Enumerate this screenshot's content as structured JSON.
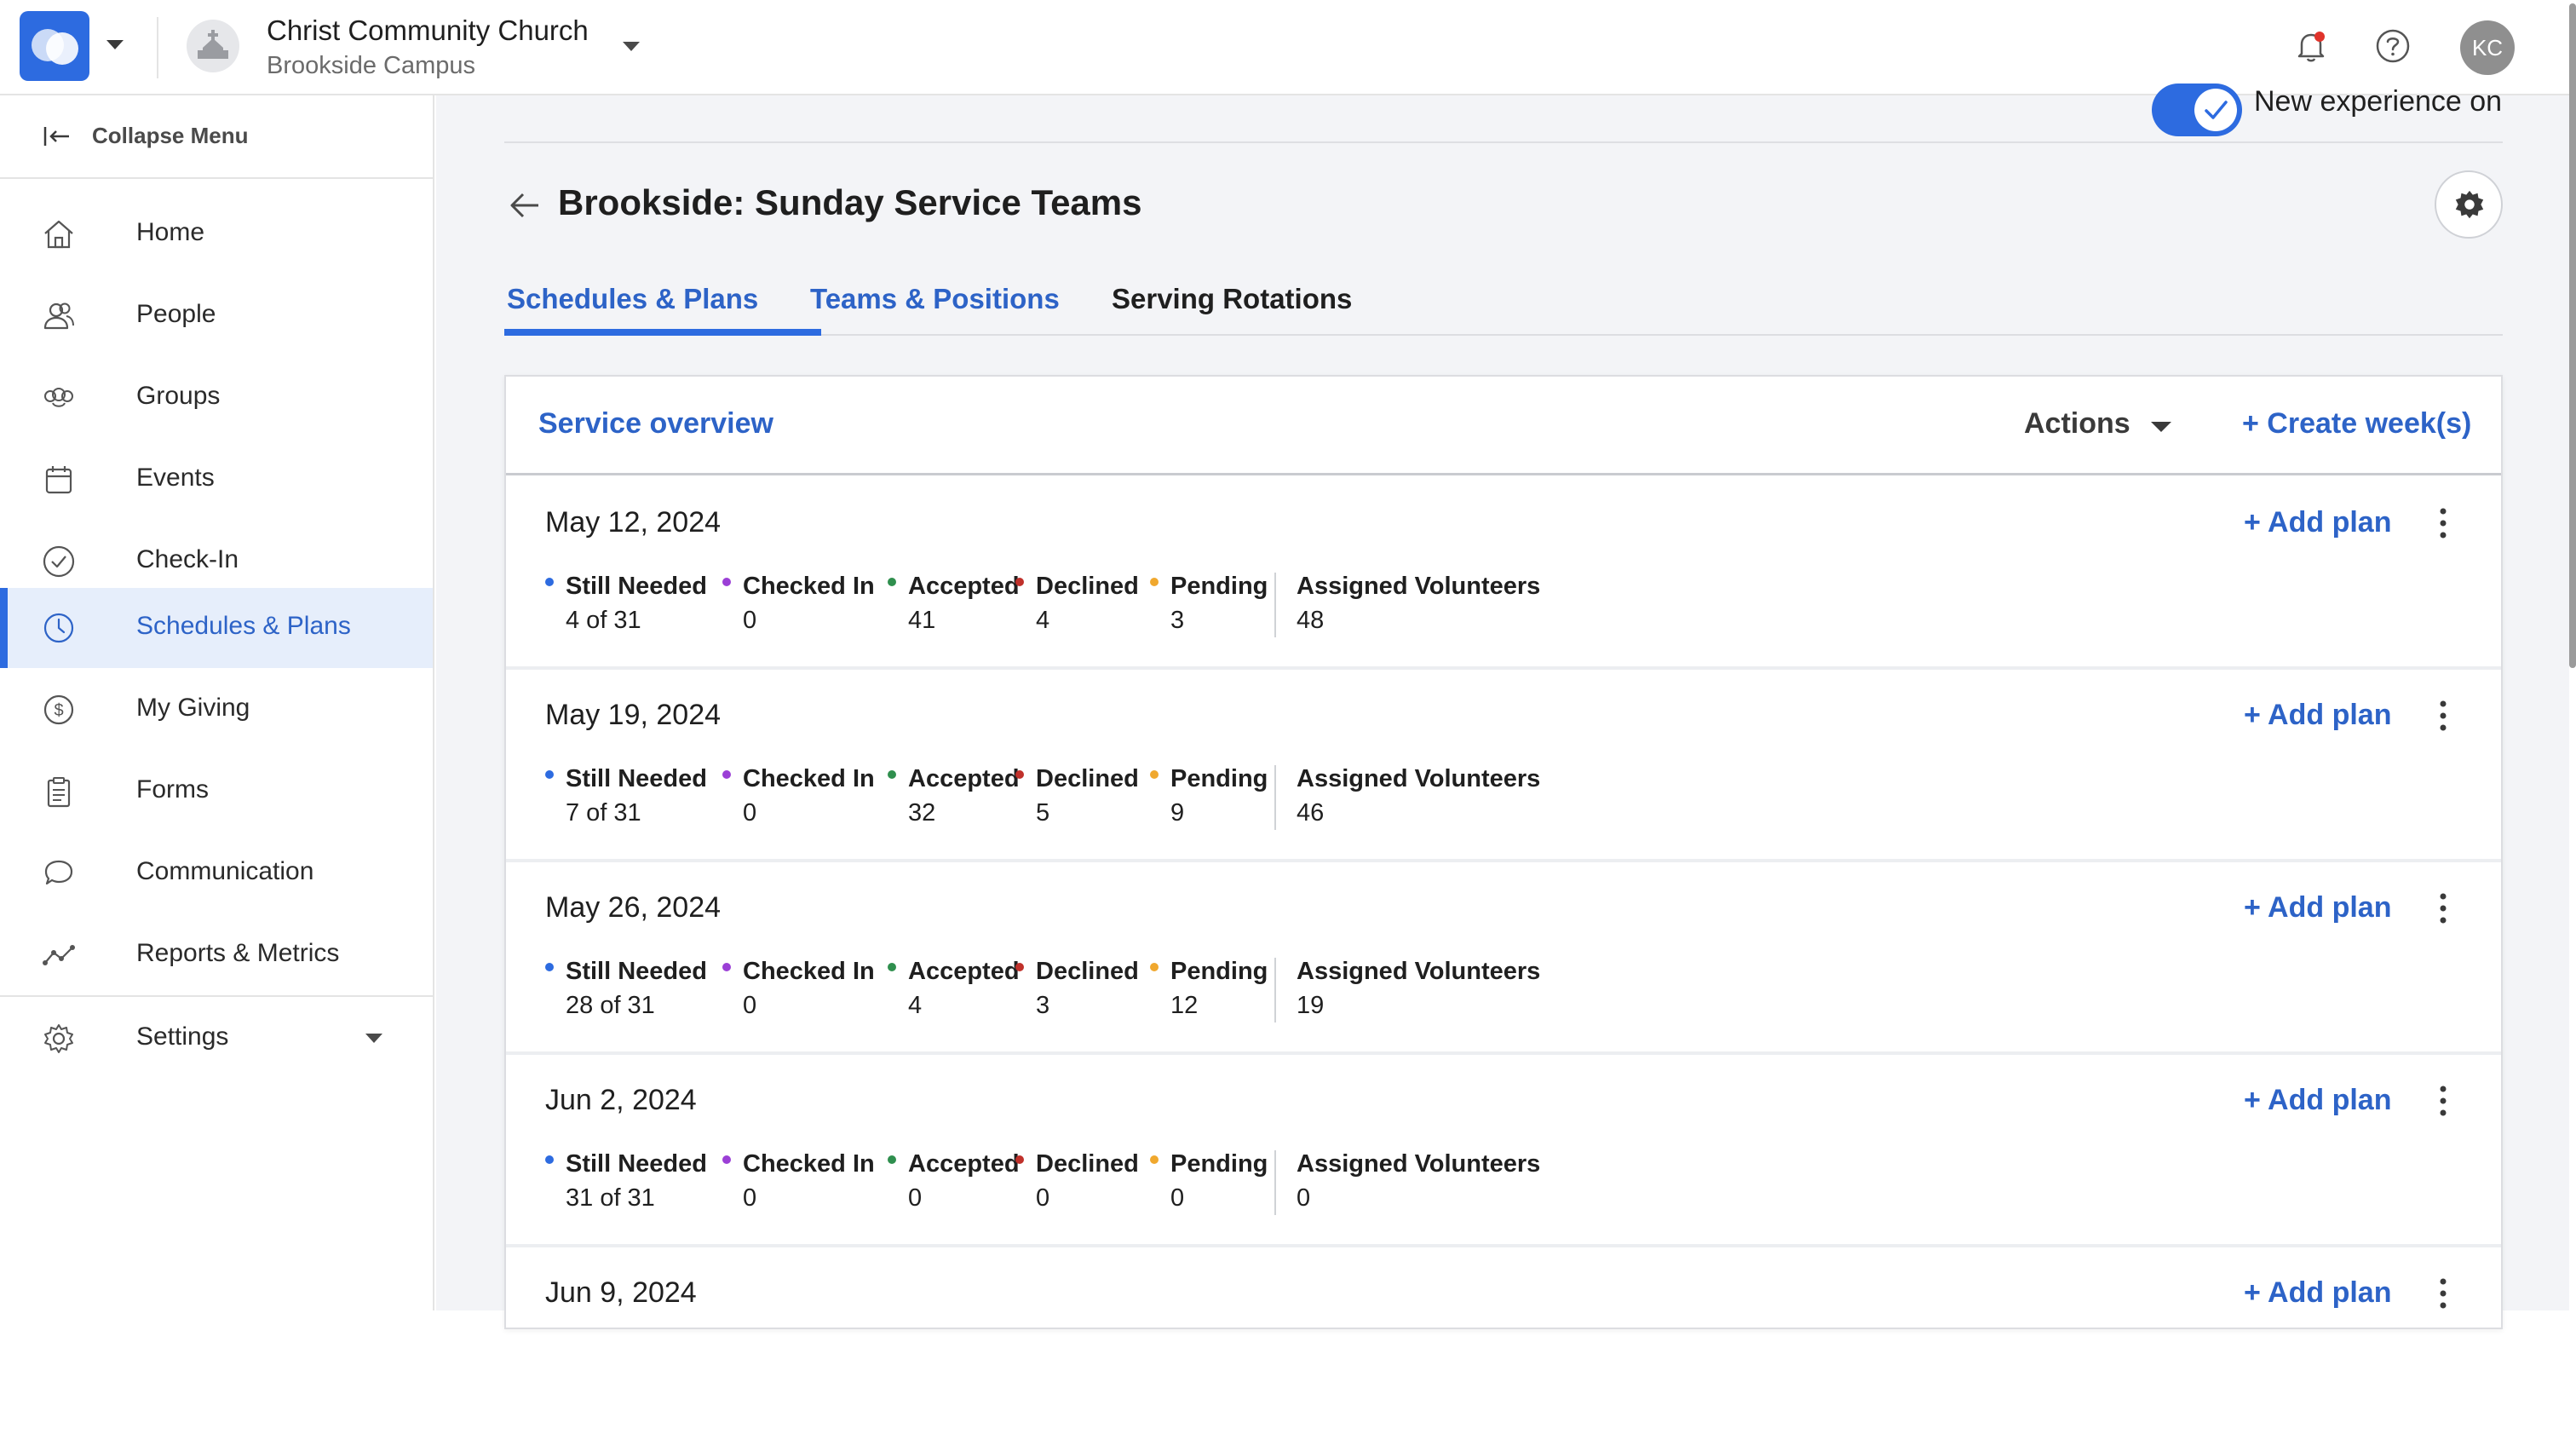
{
  "header": {
    "org_name": "Christ Community Church",
    "campus": "Brookside Campus",
    "user_initials": "KC"
  },
  "sidebar": {
    "collapse_label": "Collapse Menu",
    "items": [
      {
        "label": "Home",
        "icon": "home-icon"
      },
      {
        "label": "People",
        "icon": "people-icon"
      },
      {
        "label": "Groups",
        "icon": "groups-icon"
      },
      {
        "label": "Events",
        "icon": "calendar-icon"
      },
      {
        "label": "Check-In",
        "icon": "check-circle-icon"
      },
      {
        "label": "Schedules & Plans",
        "icon": "clock-icon",
        "active": true
      },
      {
        "label": "My Giving",
        "icon": "dollar-icon"
      },
      {
        "label": "Forms",
        "icon": "clipboard-icon"
      },
      {
        "label": "Communication",
        "icon": "chat-icon"
      },
      {
        "label": "Reports & Metrics",
        "icon": "metrics-icon"
      },
      {
        "label": "Settings",
        "icon": "gear-icon"
      }
    ]
  },
  "main": {
    "toggle_label": "New experience on",
    "toggle_on": true,
    "page_title": "Brookside: Sunday Service Teams",
    "tabs": [
      {
        "label": "Schedules & Plans",
        "active": true
      },
      {
        "label": "Teams & Positions"
      },
      {
        "label": "Serving Rotations"
      }
    ],
    "overview": {
      "title": "Service overview",
      "actions_label": "Actions",
      "create_label": "+ Create week(s)"
    },
    "labels": {
      "still_needed": "Still Needed",
      "checked_in": "Checked In",
      "accepted": "Accepted",
      "declined": "Declined",
      "pending": "Pending",
      "assigned": "Assigned Volunteers",
      "add_plan": "+ Add plan"
    },
    "weeks": [
      {
        "date": "May 12, 2024",
        "still_needed": "4 of 31",
        "checked_in": "0",
        "accepted": "41",
        "declined": "4",
        "pending": "3",
        "assigned": "48"
      },
      {
        "date": "May 19, 2024",
        "still_needed": "7 of 31",
        "checked_in": "0",
        "accepted": "32",
        "declined": "5",
        "pending": "9",
        "assigned": "46"
      },
      {
        "date": "May 26, 2024",
        "still_needed": "28 of 31",
        "checked_in": "0",
        "accepted": "4",
        "declined": "3",
        "pending": "12",
        "assigned": "19"
      },
      {
        "date": "Jun 2, 2024",
        "still_needed": "31 of 31",
        "checked_in": "0",
        "accepted": "0",
        "declined": "0",
        "pending": "0",
        "assigned": "0"
      },
      {
        "date": "Jun 9, 2024"
      }
    ]
  },
  "colors": {
    "brand_blue": "#2d6be0",
    "link_blue": "#2d63c7",
    "still_needed": "#2d6be0",
    "checked_in": "#9b3fd6",
    "accepted": "#2f8f4e",
    "declined": "#c0312b",
    "pending": "#f0a82e",
    "notification": "#e0332b"
  }
}
